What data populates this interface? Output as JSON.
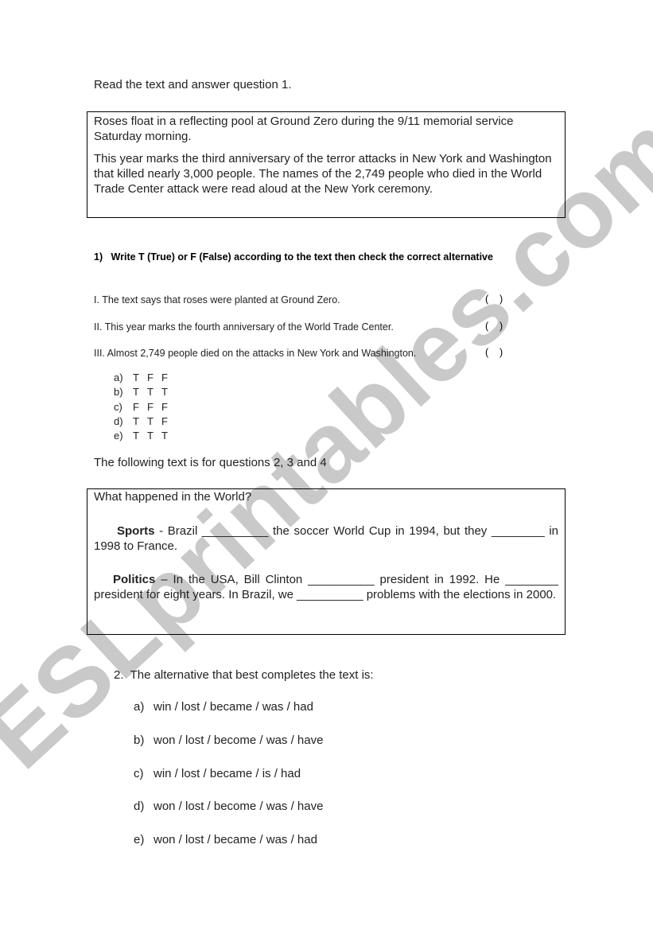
{
  "watermark": "ESLprintables.com",
  "intro": "Read the text and answer question 1.",
  "passage1": {
    "paragraphs": [
      "Roses float in a reflecting pool at Ground Zero during the 9/11 memorial service Saturday morning.",
      "This year marks the third anniversary of the terror attacks in New York and Washington that killed nearly 3,000 people. The names of the 2,749 people who died in the World Trade Center attack were read aloud at the New York ceremony."
    ]
  },
  "question1": {
    "title": "1)   Write T (True) or F (False) according to the text then check the correct alternative",
    "statements": [
      {
        "text": "I. The text says that roses were planted at Ground Zero.",
        "blank": "(    )"
      },
      {
        "text": "II. This year marks the fourth anniversary of the World Trade Center.",
        "blank": "(    )"
      },
      {
        "text": "III. Almost 2,749 people died on the attacks in New York and Washington.",
        "blank": "(    )"
      }
    ],
    "options": [
      {
        "label": "a)",
        "values": [
          "T",
          "F",
          "F"
        ]
      },
      {
        "label": "b)",
        "values": [
          "T",
          "T",
          "T"
        ]
      },
      {
        "label": "c)",
        "values": [
          "F",
          "F",
          "F"
        ]
      },
      {
        "label": "d)",
        "values": [
          "T",
          "T",
          "F"
        ]
      },
      {
        "label": "e)",
        "values": [
          "T",
          "T",
          "T"
        ]
      }
    ]
  },
  "following": "The following text is for questions 2, 3 and 4",
  "passage2": {
    "title": "What happened in the World?",
    "sports_label": "Sports",
    "sports_text": " - Brazil __________ the soccer World Cup in 1994, but they ________ in 1998 to France.",
    "politics_label": "Politics",
    "politics_text": " – In the USA, Bill Clinton __________ president in 1992. He ________ president for eight years. In Brazil, we __________ problems with the elections in 2000."
  },
  "question2": {
    "title": "2.  The alternative that best completes the text is:",
    "options": [
      {
        "label": "a)",
        "text": "win / lost / became / was / had"
      },
      {
        "label": "b)",
        "text": "won / lost / become / was / have"
      },
      {
        "label": "c)",
        "text": "win / lost / became / is / had"
      },
      {
        "label": "d)",
        "text": "won / lost / become / was / have"
      },
      {
        "label": "e)",
        "text": "won / lost / became / was / had"
      }
    ]
  }
}
